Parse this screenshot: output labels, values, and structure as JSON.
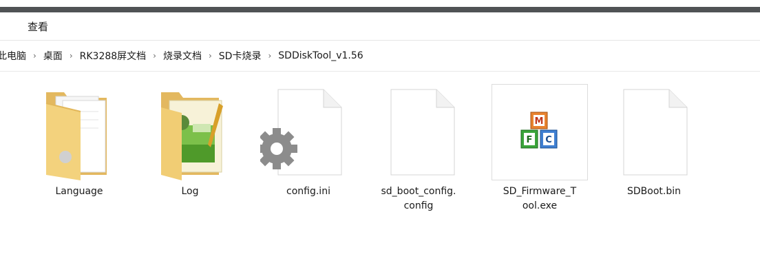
{
  "menu": {
    "view_label": "查看"
  },
  "breadcrumb": [
    "此电脑",
    "桌面",
    "RK3288屏文档",
    "烧录文档",
    "SD卡烧录",
    "SDDiskTool_v1.56"
  ],
  "breadcrumb_sep": "›",
  "files": [
    {
      "line1": "Language",
      "line2": "",
      "type": "folder",
      "icon": "folder-icon"
    },
    {
      "line1": "Log",
      "line2": "",
      "type": "folder",
      "icon": "notepad-folder-icon"
    },
    {
      "line1": "config.ini",
      "line2": "",
      "type": "settings-file",
      "icon": "gear-file-icon"
    },
    {
      "line1": "sd_boot_config.",
      "line2": "config",
      "type": "file",
      "icon": "blank-file-icon"
    },
    {
      "line1": "SD_Firmware_T",
      "line2": "ool.exe",
      "type": "exe",
      "icon": "mfc-app-icon"
    },
    {
      "line1": "SDBoot.bin",
      "line2": "",
      "type": "file",
      "icon": "blank-file-icon"
    }
  ]
}
